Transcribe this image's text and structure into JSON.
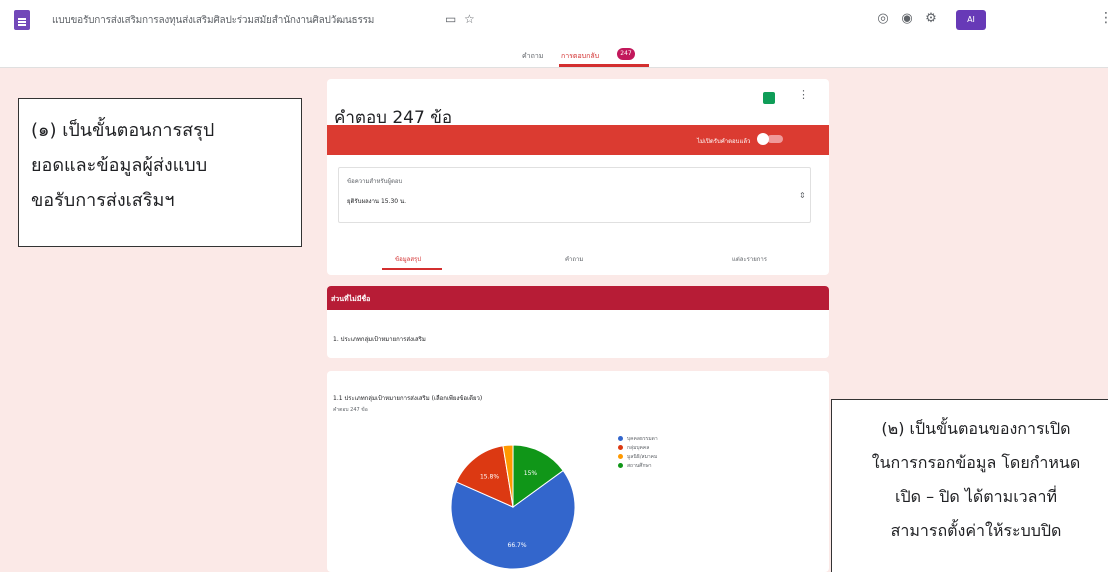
{
  "app": {
    "title": "แบบขอรับการส่งเสริมการลงทุนส่งเสริมศิลปะร่วมสมัยสำนักงานศิลปวัฒนธรรม"
  },
  "toolbar": {
    "avatar_label": "AI"
  },
  "tabs": {
    "questions": "คำถาม",
    "responses": "การตอบกลับ",
    "responses_count": "247"
  },
  "summary": {
    "title": "คำตอบ 247 ข้อ",
    "accepting_label": "ไม่เปิดรับคำตอบแล้ว",
    "message_label": "ข้อความสำหรับผู้ตอบ",
    "message_value": "ยุติรับผลงาน 15.30 น.",
    "sub_tabs": [
      "ข้อมูลสรุป",
      "คำถาม",
      "แต่ละรายการ"
    ]
  },
  "section": {
    "title": "ส่วนที่ไม่มีชื่อ",
    "question": "1. ประเภทกลุ่มเป้าหมายการส่งเสริม"
  },
  "chart": {
    "question": "1.1 ประเภทกลุ่มเป้าหมายการส่งเสริม (เลือกเพียงข้อเดียว)",
    "response_count": "คำตอบ 247 ข้อ"
  },
  "chart_data": {
    "type": "pie",
    "categories": [
      "บุคคลธรรมดา",
      "กลุ่มบุคคล",
      "มูลนิธิ/สมาคม",
      "สถานศึกษา"
    ],
    "values": [
      66.7,
      15.8,
      2.6,
      15.0
    ],
    "data_labels": [
      "66.7%",
      "15.8%",
      "",
      "15%"
    ],
    "colors": [
      "#3366cc",
      "#dc3912",
      "#ff9900",
      "#109618"
    ],
    "legend_position": "right"
  },
  "annotations": {
    "box1": [
      "(๑) เป็นขั้นตอนการสรุป",
      "ยอดและข้อมูลผู้ส่งแบบ",
      "ขอรับการส่งเสริมฯ"
    ],
    "box2": [
      "(๒) เป็นขั้นตอนของการเปิด",
      "ในการกรอกข้อมูล โดยกำหนด",
      "เปิด – ปิด ได้ตามเวลาที่",
      "สามารถตั้งค่าให้ระบบปิด"
    ]
  },
  "icons": [
    "form-icon",
    "folder-icon",
    "star-icon",
    "palette-icon",
    "preview-icon",
    "settings-icon",
    "sheets-icon",
    "more-vert-icon"
  ]
}
